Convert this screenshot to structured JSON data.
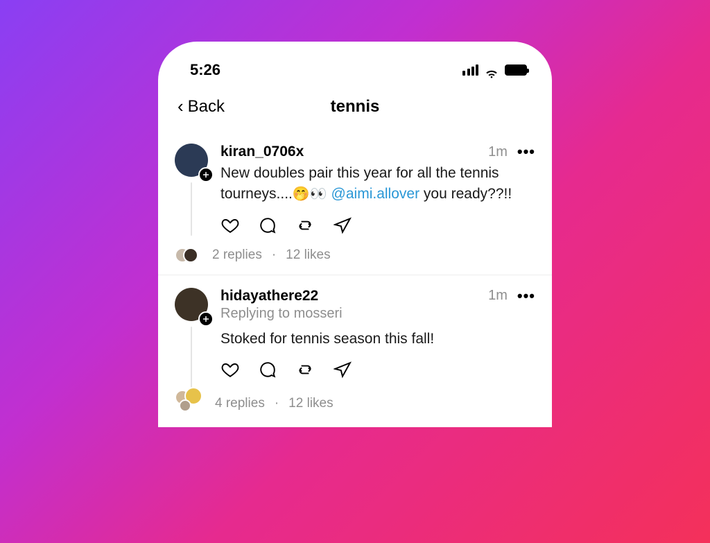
{
  "statusbar": {
    "time": "5:26"
  },
  "nav": {
    "back_label": "Back",
    "title": "tennis"
  },
  "posts": [
    {
      "username": "kiran_0706x",
      "timestamp": "1m",
      "reply_to": "",
      "body_pre": "New doubles pair this year for all the tennis tourneys....",
      "emoji": "🤭👀",
      "mention": "@aimi.allover",
      "body_post": " you ready??!!",
      "replies": "2 replies",
      "likes": "12 likes"
    },
    {
      "username": "hidayathere22",
      "timestamp": "1m",
      "reply_to": "Replying to mosseri",
      "body_pre": "Stoked for tennis season this fall!",
      "emoji": "",
      "mention": "",
      "body_post": "",
      "replies": "4 replies",
      "likes": "12 likes"
    }
  ],
  "pagination": {
    "dot": "·"
  }
}
